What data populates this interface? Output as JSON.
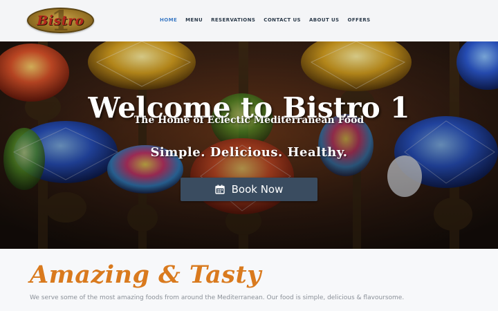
{
  "header": {
    "logo_text": "Bistro",
    "logo_numeral": "1"
  },
  "nav": {
    "items": [
      {
        "label": "HOME",
        "active": true
      },
      {
        "label": "MENU",
        "active": false
      },
      {
        "label": "RESERVATIONS",
        "active": false
      },
      {
        "label": "CONTACT US",
        "active": false
      },
      {
        "label": "ABOUT US",
        "active": false
      },
      {
        "label": "OFFERS",
        "active": false
      }
    ]
  },
  "hero": {
    "title": "Welcome to Bistro 1",
    "subtitle": "The Home of Eclectic Mediterranean Food",
    "tagline": "Simple.  Delicious.  Healthy.",
    "button_label": "Book Now",
    "button_icon": "calendar-icon"
  },
  "intro": {
    "heading": "Amazing & Tasty",
    "text": "We serve some of the most amazing foods from around the Mediterranean.  Our food is simple, delicious & flavoursome."
  },
  "colors": {
    "nav_active": "#3d7bc5",
    "nav_text": "#2b3a4a",
    "button_bg": "#3a4c60",
    "heading_accent": "#d97a1e",
    "body_text": "#8a9098"
  }
}
